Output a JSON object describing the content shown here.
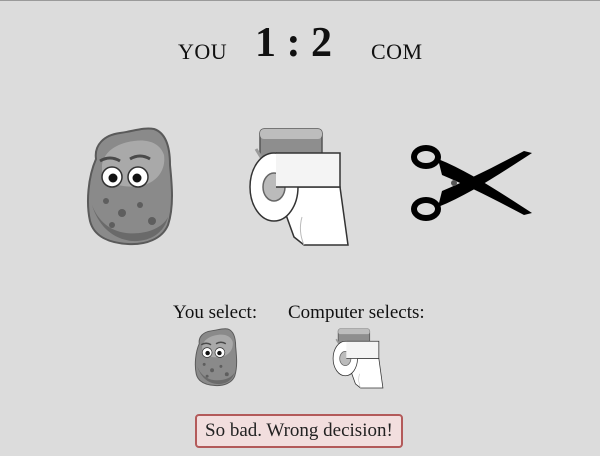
{
  "scoreboard": {
    "you_label": "YOU",
    "score": "1 : 2",
    "com_label": "COM"
  },
  "choices": [
    {
      "icon": "rock-icon"
    },
    {
      "icon": "toilet-paper-icon"
    },
    {
      "icon": "scissors-icon"
    }
  ],
  "selection": {
    "you_label": "You select:",
    "you_choice_icon": "rock-icon",
    "com_label": "Computer selects:",
    "com_choice_icon": "toilet-paper-icon"
  },
  "result": {
    "message": "So bad. Wrong decision!",
    "border_color": "#b35a5a",
    "background_color": "#f2dede"
  }
}
